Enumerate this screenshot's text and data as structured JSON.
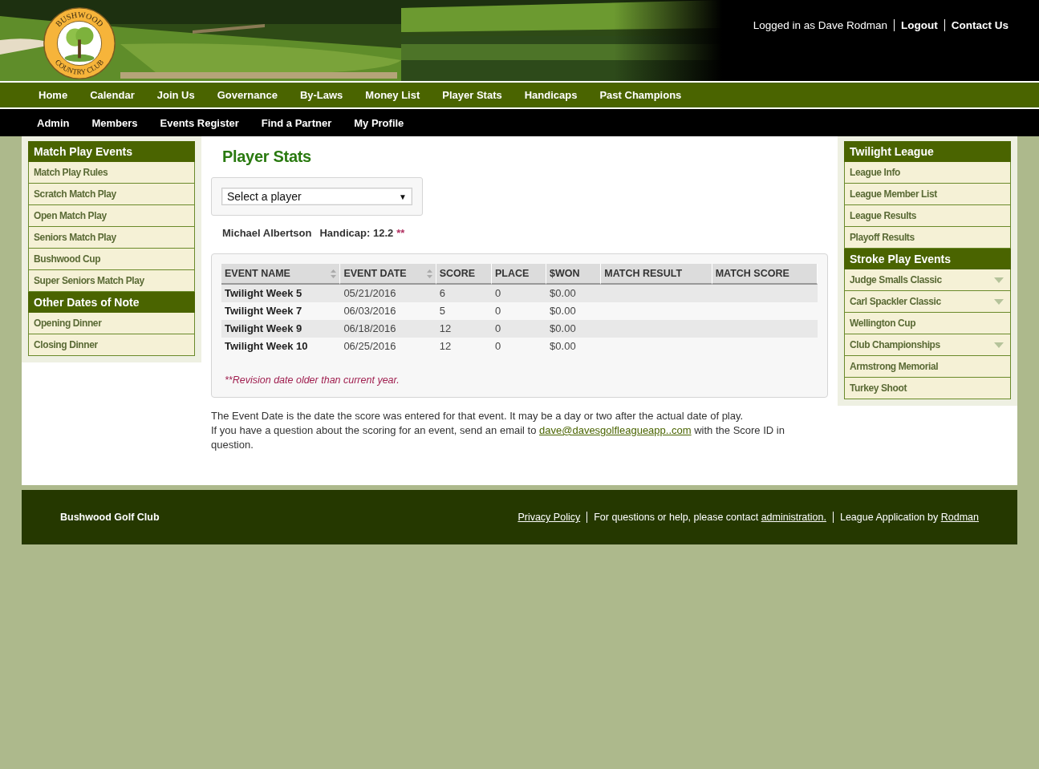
{
  "logo": {
    "top_text": "BUSHWOOD",
    "bottom_text": "COUNTRY CLUB"
  },
  "header_links": [
    {
      "text": "Logged in as Dave Rodman",
      "kind": "text"
    },
    {
      "text": "Logout",
      "kind": "link"
    },
    {
      "text": "Contact Us",
      "kind": "link"
    }
  ],
  "main_nav": [
    {
      "label": "Home"
    },
    {
      "label": "Calendar"
    },
    {
      "label": "Join Us"
    },
    {
      "label": "Governance"
    },
    {
      "label": "By-Laws"
    },
    {
      "label": "Money List"
    },
    {
      "label": "Player Stats"
    },
    {
      "label": "Handicaps"
    },
    {
      "label": "Past Champions"
    }
  ],
  "sub_nav": [
    {
      "label": "Admin"
    },
    {
      "label": "Members"
    },
    {
      "label": "Events Register"
    },
    {
      "label": "Find a Partner"
    },
    {
      "label": "My Profile"
    }
  ],
  "left_sidebar": [
    {
      "kind": "header",
      "label": "Match Play Events"
    },
    {
      "kind": "link",
      "label": "Match Play Rules",
      "expandable": false
    },
    {
      "kind": "link",
      "label": "Scratch Match Play",
      "expandable": false
    },
    {
      "kind": "link",
      "label": "Open Match Play",
      "expandable": false
    },
    {
      "kind": "link",
      "label": "Seniors Match Play",
      "expandable": false
    },
    {
      "kind": "link",
      "label": "Bushwood Cup",
      "expandable": false
    },
    {
      "kind": "link",
      "label": "Super Seniors Match Play",
      "expandable": false
    },
    {
      "kind": "header",
      "label": "Other Dates of Note"
    },
    {
      "kind": "link",
      "label": "Opening Dinner",
      "expandable": false
    },
    {
      "kind": "link",
      "label": "Closing Dinner",
      "expandable": false
    }
  ],
  "page_title": "Player Stats",
  "player_select": {
    "value": "Select a player",
    "arrow": "▼"
  },
  "player": {
    "name": "Michael Albertson",
    "handicap": "Handicap: 12.2",
    "flag": "**"
  },
  "table": {
    "columns": [
      {
        "label": "EVENT NAME",
        "sortable": true
      },
      {
        "label": "EVENT DATE",
        "sortable": true
      },
      {
        "label": "SCORE",
        "sortable": false
      },
      {
        "label": "PLACE",
        "sortable": false
      },
      {
        "label": "$WON",
        "sortable": false
      },
      {
        "label": "MATCH RESULT",
        "sortable": false
      },
      {
        "label": "MATCH SCORE",
        "sortable": false
      }
    ],
    "rows": [
      [
        "Twilight Week 5",
        "05/21/2016",
        "6",
        "0",
        "$0.00"
      ],
      [
        "Twilight Week 7",
        "06/03/2016",
        "5",
        "0",
        "$0.00"
      ],
      [
        "Twilight Week 9",
        "06/18/2016",
        "12",
        "0",
        "$0.00"
      ],
      [
        "Twilight Week 10",
        "06/25/2016",
        "12",
        "0",
        "$0.00"
      ]
    ],
    "footnote": "**Revision date older than current year."
  },
  "info": {
    "line_1": "The Event Date is the date the score was entered for that event. It may be a day or two after the actual date of play.",
    "line_2_before": "If you have a question about the scoring for an event, send an email to ",
    "email": "dave@davesgolfleagueapp..com",
    "line_2_after": " with the Score ID in question."
  },
  "right_sidebar": [
    {
      "kind": "header",
      "label": "Twilight League"
    },
    {
      "kind": "link",
      "label": "League Info",
      "expandable": false
    },
    {
      "kind": "link",
      "label": "League Member List",
      "expandable": false
    },
    {
      "kind": "link",
      "label": "League Results",
      "expandable": false
    },
    {
      "kind": "link",
      "label": "Playoff Results",
      "expandable": false
    },
    {
      "kind": "header",
      "label": "Stroke Play Events"
    },
    {
      "kind": "link",
      "label": "Judge Smalls Classic",
      "expandable": true
    },
    {
      "kind": "link",
      "label": "Carl Spackler Classic",
      "expandable": true
    },
    {
      "kind": "link",
      "label": "Wellington Cup",
      "expandable": false
    },
    {
      "kind": "link",
      "label": "Club Championships",
      "expandable": true
    },
    {
      "kind": "link",
      "label": "Armstrong Memorial",
      "expandable": false
    },
    {
      "kind": "link",
      "label": "Turkey Shoot",
      "expandable": false
    }
  ],
  "footer": {
    "club": "Bushwood Golf Club",
    "items": [
      {
        "kind": "link",
        "text": "Privacy Policy"
      },
      {
        "kind": "sentence",
        "text": "For questions or help, please contact ",
        "link": "administration."
      },
      {
        "kind": "sentence",
        "text": "League Application by ",
        "link": "Rodman"
      }
    ]
  }
}
